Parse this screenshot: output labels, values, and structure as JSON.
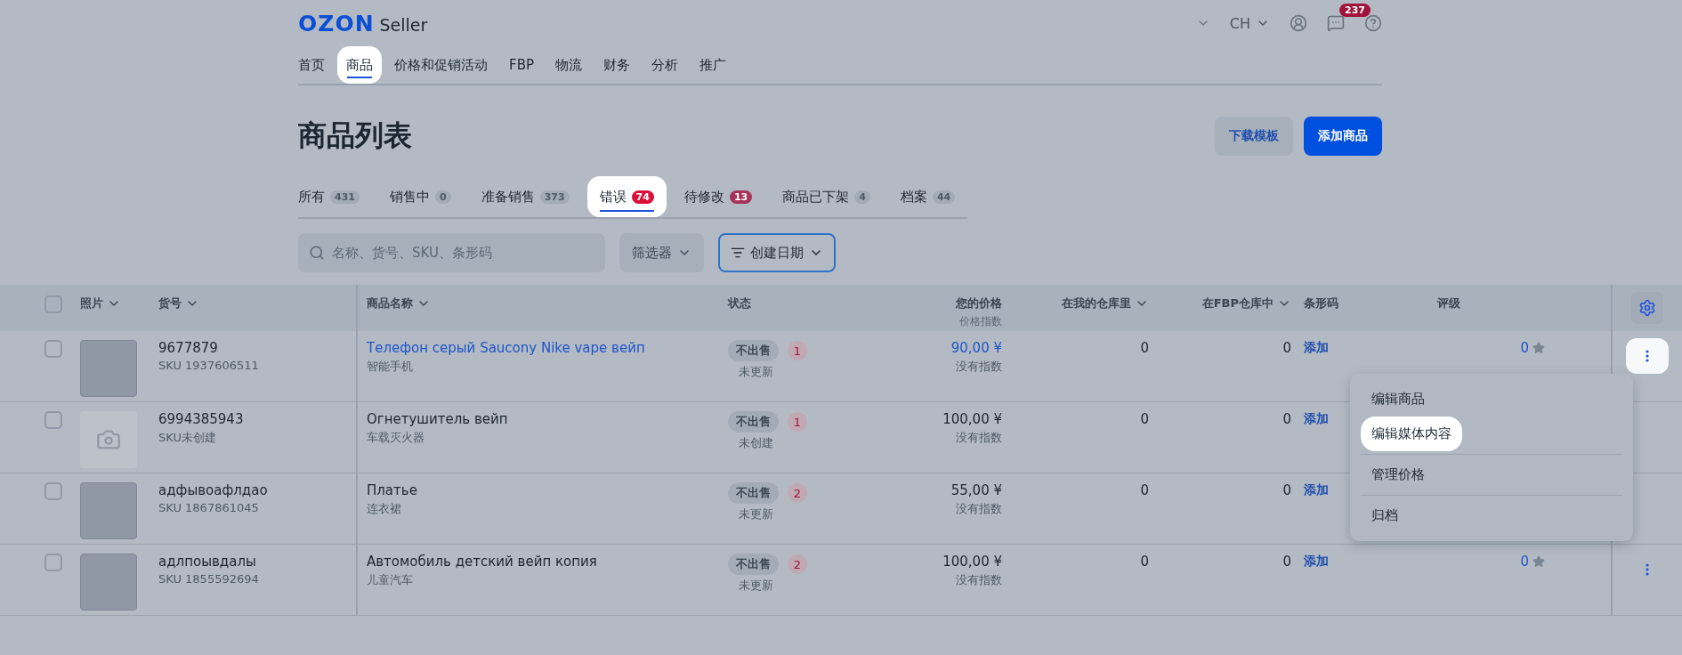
{
  "header": {
    "logo": "OZON",
    "logo_suffix": "Seller",
    "language": "CH",
    "notification_count": "237"
  },
  "nav": [
    {
      "label": "首页",
      "selected": false,
      "highlighted": false
    },
    {
      "label": "商品",
      "selected": true,
      "highlighted": true
    },
    {
      "label": "价格和促销活动",
      "selected": false,
      "highlighted": false
    },
    {
      "label": "FBP",
      "selected": false,
      "highlighted": false
    },
    {
      "label": "物流",
      "selected": false,
      "highlighted": false
    },
    {
      "label": "财务",
      "selected": false,
      "highlighted": false
    },
    {
      "label": "分析",
      "selected": false,
      "highlighted": false
    },
    {
      "label": "推广",
      "selected": false,
      "highlighted": false
    }
  ],
  "page_title": "商品列表",
  "actions": [
    {
      "label": "下载模板",
      "kind": "secondary"
    },
    {
      "label": "添加商品",
      "kind": "primary"
    }
  ],
  "tabs": [
    {
      "label": "所有",
      "count": "431",
      "color": "#a2abb6",
      "selected": false,
      "highlighted": false
    },
    {
      "label": "销售中",
      "count": "0",
      "color": "#a2abb6",
      "selected": false,
      "highlighted": false
    },
    {
      "label": "准备销售",
      "count": "373",
      "color": "#a2abb6",
      "selected": false,
      "highlighted": false
    },
    {
      "label": "错误",
      "count": "74",
      "color": "#d8103a",
      "selected": true,
      "highlighted": true
    },
    {
      "label": "待修改",
      "count": "13",
      "color": "#a8335a",
      "selected": false,
      "highlighted": false
    },
    {
      "label": "商品已下架",
      "count": "4",
      "color": "#a2abb6",
      "selected": false,
      "highlighted": false
    },
    {
      "label": "档案",
      "count": "44",
      "color": "#a2abb6",
      "selected": false,
      "highlighted": false
    }
  ],
  "search": {
    "placeholder": "名称、货号、SKU、条形码"
  },
  "filter_button": "筛选器",
  "sort_button": "创建日期",
  "table": {
    "select_all_checked": false,
    "columns": [
      {
        "label": "照片",
        "sortable": true
      },
      {
        "label": "货号",
        "sortable": true
      },
      {
        "label": "商品名称",
        "sortable": true
      },
      {
        "label": "状态",
        "sortable": false
      },
      {
        "label": "您的价格",
        "sublabel": "价格指数",
        "sortable": false
      },
      {
        "label": "在我的仓库里",
        "sortable": true
      },
      {
        "label": "在FBP仓库中",
        "sortable": true
      },
      {
        "label": "条形码",
        "sortable": false
      },
      {
        "label": "评级",
        "sortable": false
      }
    ],
    "rows": [
      {
        "checked": false,
        "has_photo": true,
        "article": "9677879",
        "sku": "SKU 1937606511",
        "name": "Телефон серый Saucony Nike vape вейп",
        "name_link": true,
        "category": "智能手机",
        "status": "不出售",
        "errors": "1",
        "status_note": "未更新",
        "price": "90,00 ¥",
        "price_link": true,
        "price_index": "没有指数",
        "my_stock": "0",
        "fbp_stock": "0",
        "barcode": "添加",
        "rating": "0",
        "menu_button": true,
        "menu_highlighted": true
      },
      {
        "checked": false,
        "has_photo": false,
        "article": "6994385943",
        "sku": "SKU未创建",
        "name": "Огнетушитель вейп",
        "name_link": false,
        "category": "车载灭火器",
        "status": "不出售",
        "errors": "1",
        "status_note": "未创建",
        "price": "100,00 ¥",
        "price_link": false,
        "price_index": "没有指数",
        "my_stock": "0",
        "fbp_stock": "0",
        "barcode": "添加",
        "menu_button": false
      },
      {
        "checked": false,
        "has_photo": true,
        "article": "адфывоафлдао",
        "sku": "SKU 1867861045",
        "name": "Платье",
        "name_link": false,
        "category": "连衣裙",
        "status": "不出售",
        "errors": "2",
        "status_note": "未更新",
        "price": "55,00 ¥",
        "price_link": false,
        "price_index": "没有指数",
        "my_stock": "0",
        "fbp_stock": "0",
        "barcode": "添加",
        "menu_button": false
      },
      {
        "checked": false,
        "has_photo": true,
        "article": "адлпоывдалы",
        "sku": "SKU 1855592694",
        "name": "Автомобиль детский вейп копия",
        "name_link": false,
        "category": "儿童汽车",
        "status": "不出售",
        "errors": "2",
        "status_note": "未更新",
        "price": "100,00 ¥",
        "price_link": false,
        "price_index": "没有指数",
        "my_stock": "0",
        "fbp_stock": "0",
        "barcode": "添加",
        "rating": "0",
        "menu_button": true,
        "menu_highlighted": false
      }
    ]
  },
  "row_menu": {
    "groups": [
      [
        {
          "label": "编辑商品",
          "highlighted": false
        },
        {
          "label": "编辑媒体内容",
          "highlighted": true
        }
      ],
      [
        {
          "label": "管理价格",
          "highlighted": false
        }
      ],
      [
        {
          "label": "归档",
          "highlighted": false
        }
      ]
    ]
  }
}
